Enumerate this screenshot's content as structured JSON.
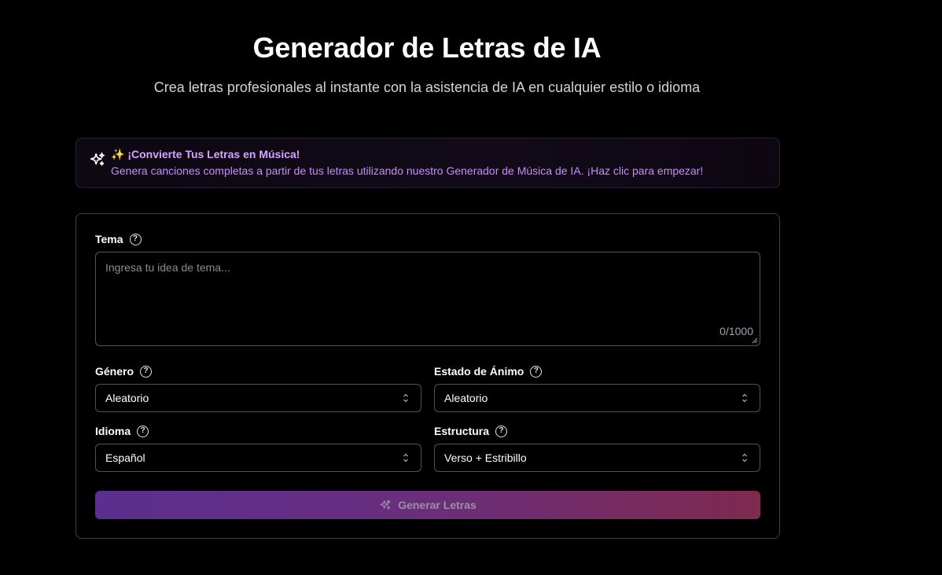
{
  "header": {
    "title": "Generador de Letras de IA",
    "subtitle": "Crea letras profesionales al instante con la asistencia de IA en cualquier estilo o idioma"
  },
  "promo": {
    "title": "✨ ¡Convierte Tus Letras en Música!",
    "description": "Genera canciones completas a partir de tus letras utilizando nuestro Generador de Música de IA. ¡Haz clic para empezar!",
    "icon": "sparkles-icon"
  },
  "form": {
    "theme": {
      "label": "Tema",
      "placeholder": "Ingresa tu idea de tema...",
      "value": "",
      "counter": "0/1000"
    },
    "genre": {
      "label": "Género",
      "value": "Aleatorio"
    },
    "mood": {
      "label": "Estado de Ánimo",
      "value": "Aleatorio"
    },
    "language": {
      "label": "Idioma",
      "value": "Español"
    },
    "structure": {
      "label": "Estructura",
      "value": "Verso + Estribillo"
    },
    "generate_button": "Generar Letras"
  },
  "colors": {
    "background": "#000000",
    "promo_text": "#c98cff",
    "button_gradient_start": "#5b2f8f",
    "button_gradient_end": "#7f2a4f"
  }
}
